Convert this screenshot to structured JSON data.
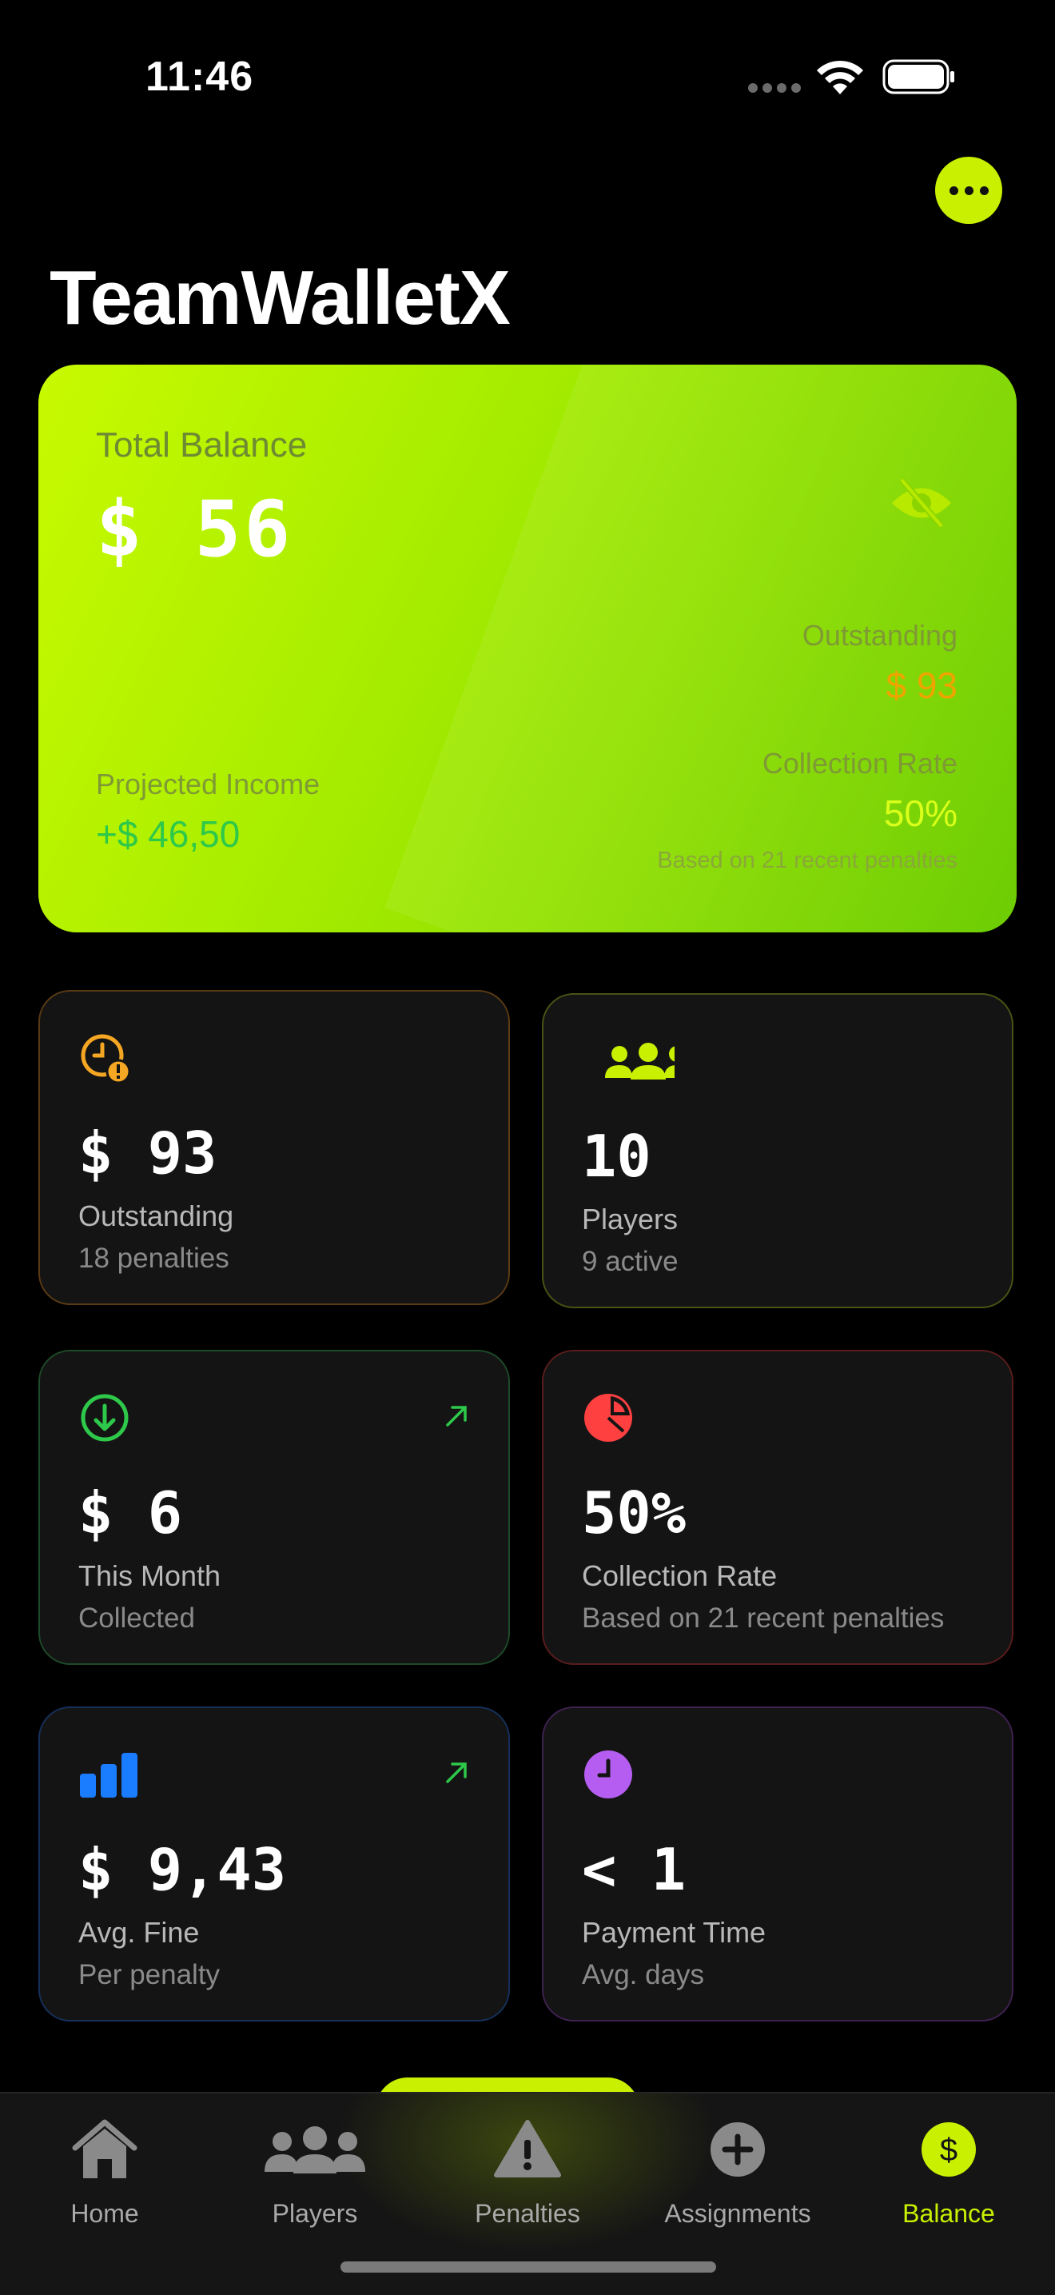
{
  "status_bar": {
    "time": "11:46"
  },
  "header": {
    "title": "TeamWalletX",
    "more_icon": "ellipsis-icon"
  },
  "balance_card": {
    "label": "Total Balance",
    "amount": "$ 56",
    "outstanding_label": "Outstanding",
    "outstanding_value": "$ 93",
    "projected_label": "Projected Income",
    "projected_value": "+$ 46,50",
    "rate_label": "Collection Rate",
    "rate_value": "50%",
    "rate_note": "Based on 21 recent penalties",
    "colors": {
      "gradient_start": "#c8fa00",
      "gradient_end": "#6bcc00"
    }
  },
  "stats": [
    {
      "value": "$ 93",
      "label": "Outstanding",
      "sub": "18 penalties",
      "icon": "clock-alert-icon",
      "color": "#f5a623"
    },
    {
      "value": "10",
      "label": "Players",
      "sub": "9 active",
      "icon": "people-icon",
      "color": "#c8f000"
    },
    {
      "value": "$ 6",
      "label": "This Month",
      "sub": "Collected",
      "icon": "arrow-down-circle-icon",
      "color": "#2ec84a"
    },
    {
      "value": "50%",
      "label": "Collection Rate",
      "sub": "Based on 21 recent penalties",
      "icon": "pie-chart-icon",
      "color": "#ff4040"
    },
    {
      "value": "$ 9,43",
      "label": "Avg. Fine",
      "sub": "Per penalty",
      "icon": "bar-chart-icon",
      "color": "#1a7cff"
    },
    {
      "value": "< 1",
      "label": "Payment Time",
      "sub": "Avg. days",
      "icon": "clock-icon",
      "color": "#b45df0"
    }
  ],
  "tabs": [
    {
      "label": "Home",
      "icon": "house-icon",
      "active": false
    },
    {
      "label": "Players",
      "icon": "people-icon",
      "active": false
    },
    {
      "label": "Penalties",
      "icon": "warning-triangle-icon",
      "active": false
    },
    {
      "label": "Assignments",
      "icon": "plus-circle-icon",
      "active": false
    },
    {
      "label": "Balance",
      "icon": "dollar-circle-icon",
      "active": true
    }
  ],
  "accent_color": "#c8f000"
}
